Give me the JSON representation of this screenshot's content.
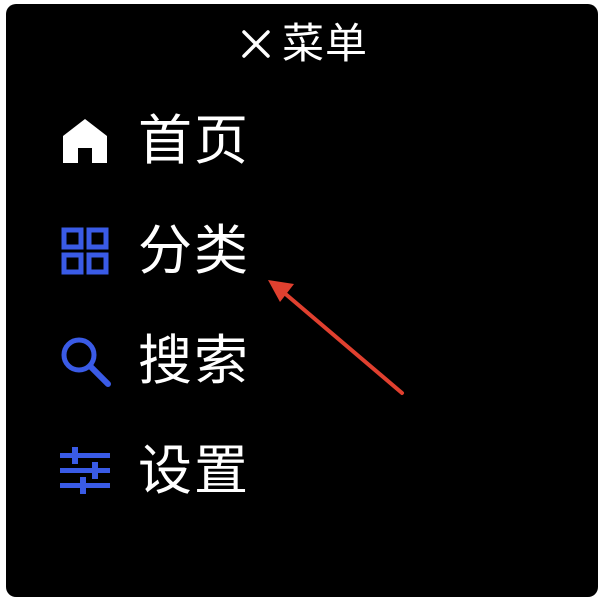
{
  "header": {
    "title": "菜单",
    "close_icon": "close-icon"
  },
  "menu": {
    "items": [
      {
        "label": "首页",
        "icon": "home-icon",
        "icon_color": "#ffffff"
      },
      {
        "label": "分类",
        "icon": "grid-icon",
        "icon_color": "#3a5be6"
      },
      {
        "label": "搜索",
        "icon": "search-icon",
        "icon_color": "#3a5be6"
      },
      {
        "label": "设置",
        "icon": "sliders-icon",
        "icon_color": "#3a5be6"
      }
    ]
  },
  "colors": {
    "background": "#000000",
    "text": "#ffffff",
    "accent": "#3a5be6",
    "annotation_arrow": "#e0402f"
  }
}
